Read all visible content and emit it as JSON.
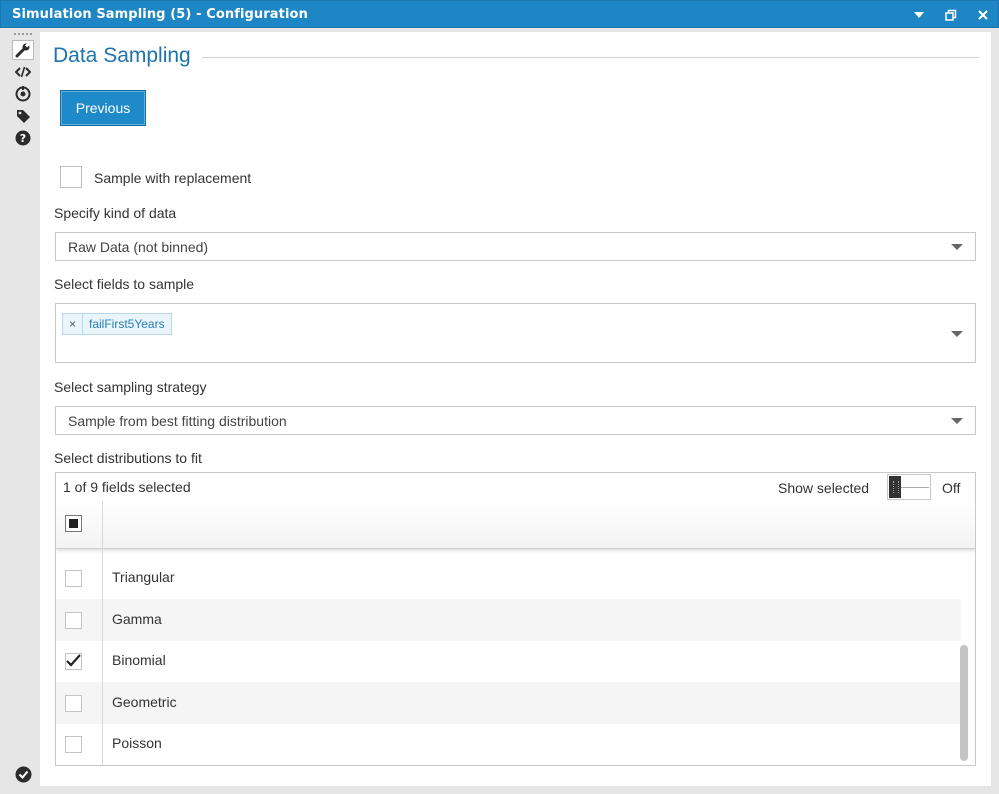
{
  "window": {
    "title": "Simulation Sampling (5) - Configuration"
  },
  "toolbar": {
    "icons": [
      "wrench-icon",
      "code-icon",
      "target-icon",
      "tag-icon",
      "help-icon"
    ]
  },
  "page": {
    "heading": "Data Sampling",
    "previous_label": "Previous"
  },
  "replacement": {
    "label": "Sample with replacement",
    "checked": false
  },
  "kind_of_data": {
    "label": "Specify kind of data",
    "value": "Raw Data (not binned)"
  },
  "fields": {
    "label": "Select fields to sample",
    "tags": [
      "failFirst5Years"
    ],
    "remove_symbol": "×"
  },
  "strategy": {
    "label": "Select sampling strategy",
    "value": "Sample from best fitting distribution"
  },
  "distributions": {
    "label": "Select distributions to fit",
    "count_text": "1 of 9 fields selected",
    "show_selected_label": "Show selected",
    "toggle_state": "Off",
    "rows": [
      {
        "label": "Triangular",
        "checked": false
      },
      {
        "label": "Gamma",
        "checked": false
      },
      {
        "label": "Binomial",
        "checked": true
      },
      {
        "label": "Geometric",
        "checked": false
      },
      {
        "label": "Poisson",
        "checked": false
      }
    ]
  },
  "colors": {
    "title_bar": "#1e86c4",
    "accent": "#1d73ad",
    "button": "#1f8ac9"
  }
}
